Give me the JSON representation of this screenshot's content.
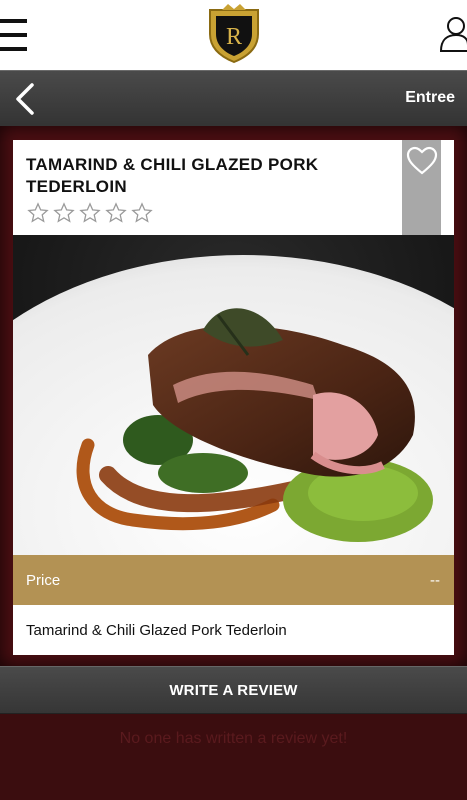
{
  "header": {
    "logo_letter": "R",
    "icons": [
      "menu-icon",
      "logo",
      "profile-icon"
    ]
  },
  "nav": {
    "category": "Entree",
    "back_icon": "chevron-left-icon"
  },
  "dish": {
    "title": "TAMARIND & CHILI GLAZED PORK TEDERLOIN",
    "rating": 0,
    "rating_max": 5,
    "favorite_icon": "heart-outline-icon",
    "price_label": "Price",
    "price_value": "--",
    "description": "Tamarind & Chili Glazed Pork Tederloin"
  },
  "reviews": {
    "button_label": "WRITE A REVIEW",
    "empty_message": "No one has written a review yet!"
  },
  "colors": {
    "background": "#3b0d0f",
    "accent_gold": "#b39254",
    "nav_dark": "#3a3a3a",
    "favorite_box": "#a8a8a8"
  }
}
